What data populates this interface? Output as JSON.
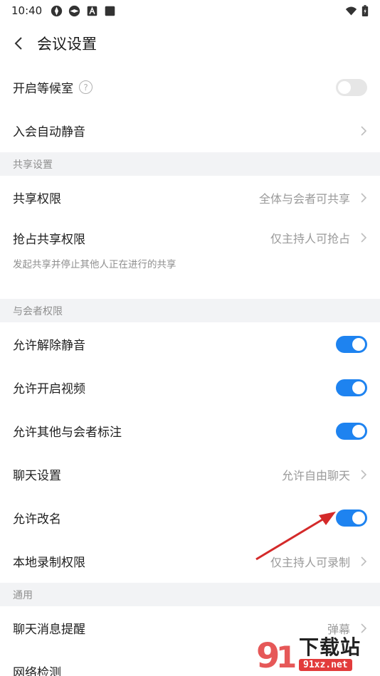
{
  "status_bar": {
    "time": "10:40"
  },
  "header": {
    "title": "会议设置"
  },
  "rows_top": [
    {
      "label": "开启等候室",
      "type": "toggle",
      "on": false,
      "help": "?"
    },
    {
      "label": "入会自动静音",
      "type": "chevron"
    }
  ],
  "section_share": {
    "title": "共享设置",
    "rows": [
      {
        "label": "共享权限",
        "value": "全体与会者可共享"
      },
      {
        "label": "抢占共享权限",
        "value": "仅主持人可抢占"
      }
    ],
    "desc": "发起共享并停止其他人正在进行的共享"
  },
  "section_perm": {
    "title": "与会者权限",
    "rows": [
      {
        "label": "允许解除静音",
        "type": "toggle",
        "on": true
      },
      {
        "label": "允许开启视频",
        "type": "toggle",
        "on": true
      },
      {
        "label": "允许其他与会者标注",
        "type": "toggle",
        "on": true
      },
      {
        "label": "聊天设置",
        "type": "chevron",
        "value": "允许自由聊天"
      },
      {
        "label": "允许改名",
        "type": "toggle",
        "on": true
      },
      {
        "label": "本地录制权限",
        "type": "chevron",
        "value": "仅主持人可录制"
      }
    ]
  },
  "section_general": {
    "title": "通用",
    "rows": [
      {
        "label": "聊天消息提醒",
        "value": "弹幕"
      },
      {
        "label": "网络检测"
      }
    ]
  },
  "watermark": {
    "title": "下载站",
    "url": "91xz.net"
  },
  "colors": {
    "accent": "#1e83f0",
    "section_bg": "#f2f3f5",
    "arrow": "#d42a2a"
  }
}
